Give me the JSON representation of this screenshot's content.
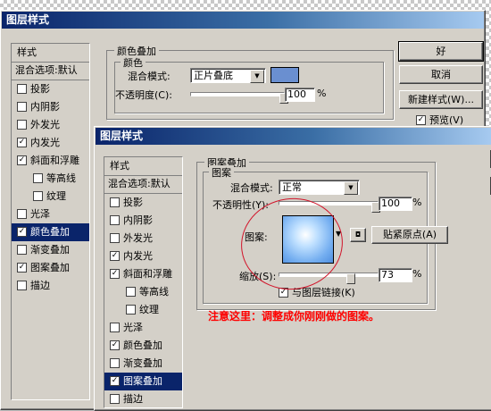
{
  "bg_dialog": {
    "title": "图层样式",
    "styles_header": "样式",
    "blend_options": "混合选项:默认",
    "items": [
      {
        "label": "投影",
        "checked": false,
        "indent": false,
        "selected": false
      },
      {
        "label": "内阴影",
        "checked": false,
        "indent": false,
        "selected": false
      },
      {
        "label": "外发光",
        "checked": false,
        "indent": false,
        "selected": false
      },
      {
        "label": "内发光",
        "checked": true,
        "indent": false,
        "selected": false
      },
      {
        "label": "斜面和浮雕",
        "checked": true,
        "indent": false,
        "selected": false
      },
      {
        "label": "等高线",
        "checked": false,
        "indent": true,
        "selected": false
      },
      {
        "label": "纹理",
        "checked": false,
        "indent": true,
        "selected": false
      },
      {
        "label": "光泽",
        "checked": false,
        "indent": false,
        "selected": false
      },
      {
        "label": "颜色叠加",
        "checked": true,
        "indent": false,
        "selected": true
      },
      {
        "label": "渐变叠加",
        "checked": false,
        "indent": false,
        "selected": false
      },
      {
        "label": "图案叠加",
        "checked": true,
        "indent": false,
        "selected": false
      },
      {
        "label": "描边",
        "checked": false,
        "indent": false,
        "selected": false
      }
    ],
    "color_overlay_group": "颜色叠加",
    "color_group": "颜色",
    "blend_mode_label": "混合模式:",
    "blend_mode_value": "正片叠底",
    "opacity_label": "不透明度(C):",
    "opacity_value": "100",
    "percent": "%",
    "overlay_color": "#6a8fd0",
    "ok": "好",
    "cancel": "取消",
    "new_style": "新建样式(W)...",
    "preview": "预览(V)",
    "preview_checked": true
  },
  "fg_dialog": {
    "title": "图层样式",
    "styles_header": "样式",
    "blend_options": "混合选项:默认",
    "items": [
      {
        "label": "投影",
        "checked": false,
        "indent": false,
        "selected": false
      },
      {
        "label": "内阴影",
        "checked": false,
        "indent": false,
        "selected": false
      },
      {
        "label": "外发光",
        "checked": false,
        "indent": false,
        "selected": false
      },
      {
        "label": "内发光",
        "checked": true,
        "indent": false,
        "selected": false
      },
      {
        "label": "斜面和浮雕",
        "checked": true,
        "indent": false,
        "selected": false
      },
      {
        "label": "等高线",
        "checked": false,
        "indent": true,
        "selected": false
      },
      {
        "label": "纹理",
        "checked": false,
        "indent": true,
        "selected": false
      },
      {
        "label": "光泽",
        "checked": false,
        "indent": false,
        "selected": false
      },
      {
        "label": "颜色叠加",
        "checked": true,
        "indent": false,
        "selected": false
      },
      {
        "label": "渐变叠加",
        "checked": false,
        "indent": false,
        "selected": false
      },
      {
        "label": "图案叠加",
        "checked": true,
        "indent": false,
        "selected": true
      },
      {
        "label": "描边",
        "checked": false,
        "indent": false,
        "selected": false
      }
    ],
    "pattern_overlay_group": "图案叠加",
    "pattern_group": "图案",
    "blend_mode_label": "混合模式:",
    "blend_mode_value": "正常",
    "opacity_label": "不透明性(Y):",
    "opacity_value": "100",
    "pattern_label": "图案:",
    "snap_button": "贴紧原点(A)",
    "scale_label": "缩放(S):",
    "scale_value": "73",
    "scale_fraction": 0.73,
    "opacity_fraction": 1.0,
    "link_label": "与图层链接(K)",
    "link_checked": true,
    "percent": "%"
  },
  "annotation": "注意这里：调整成你刚刚做的图案。"
}
